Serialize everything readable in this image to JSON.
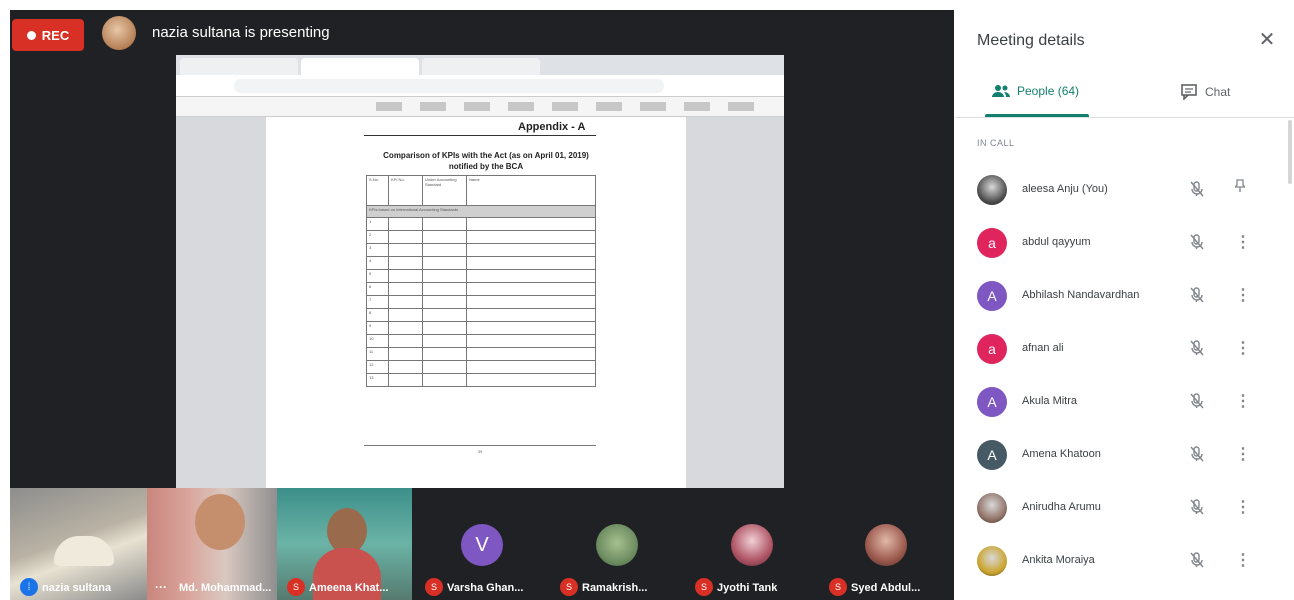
{
  "recording": {
    "label": "REC"
  },
  "presenter": {
    "banner": "nazia sultana is presenting"
  },
  "shared_screen": {
    "tabs": [
      "",
      "",
      ""
    ],
    "url": "",
    "document": {
      "heading": "Appendix - A",
      "title_lines": [
        "Comparison of KPIs with the Act (as on April 01, 2019)",
        "notified by the BCA"
      ],
      "table_headers": [
        "S.No.",
        "KPI No.",
        "Under Accounting Standard",
        "Name"
      ],
      "band_row": "KPIs based on International Accounting Standards",
      "rows": [
        [
          "1",
          "",
          "",
          ""
        ],
        [
          "2",
          "",
          "",
          ""
        ],
        [
          "3",
          "",
          "",
          ""
        ],
        [
          "4",
          "",
          "",
          ""
        ],
        [
          "5",
          "",
          "",
          ""
        ],
        [
          "6",
          "",
          "",
          ""
        ],
        [
          "7",
          "",
          "",
          ""
        ],
        [
          "8",
          "",
          "",
          ""
        ],
        [
          "9",
          "",
          "",
          ""
        ],
        [
          "10",
          "",
          "",
          ""
        ],
        [
          "11",
          "",
          "",
          ""
        ],
        [
          "12",
          "",
          "",
          ""
        ],
        [
          "13",
          "",
          "",
          ""
        ]
      ],
      "footnote": "",
      "page_number": "39"
    }
  },
  "video_tiles": [
    {
      "name": "nazia sultana",
      "status": "speaking"
    },
    {
      "name": "Md. Mohammad...",
      "status": "more"
    },
    {
      "name": "Ameena Khat...",
      "status": "muted"
    }
  ],
  "avatar_tiles": [
    {
      "name": "Varsha Ghan...",
      "initial": "V",
      "color": "#7e57c2"
    },
    {
      "name": "Ramakrish...",
      "initial": "",
      "color": "#6f8f63"
    },
    {
      "name": "Jyothi Tank",
      "initial": "",
      "color": "#b05566"
    },
    {
      "name": "Syed Abdul...",
      "initial": "",
      "color": "#9c5a4e"
    }
  ],
  "panel": {
    "title": "Meeting details",
    "close_icon": "close-icon",
    "tabs": {
      "people": "People (64)",
      "chat": "Chat"
    },
    "section": "IN CALL",
    "participants": [
      {
        "name": "aleesa Anju (You)",
        "initial": "",
        "color": "#4a4a4a",
        "photo": true
      },
      {
        "name": "abdul qayyum",
        "initial": "a",
        "color": "#e0245e"
      },
      {
        "name": "Abhilash Nandavardhan",
        "initial": "A",
        "color": "#7e57c2"
      },
      {
        "name": "afnan ali",
        "initial": "a",
        "color": "#e0245e"
      },
      {
        "name": "Akula Mitra",
        "initial": "A",
        "color": "#7e57c2"
      },
      {
        "name": "Amena Khatoon",
        "initial": "A",
        "color": "#455a64"
      },
      {
        "name": "Anirudha Arumu",
        "initial": "",
        "color": "#8d6e63",
        "photo": true
      },
      {
        "name": "Ankita Moraiya",
        "initial": "",
        "color": "#c9a227",
        "photo": true
      }
    ]
  }
}
